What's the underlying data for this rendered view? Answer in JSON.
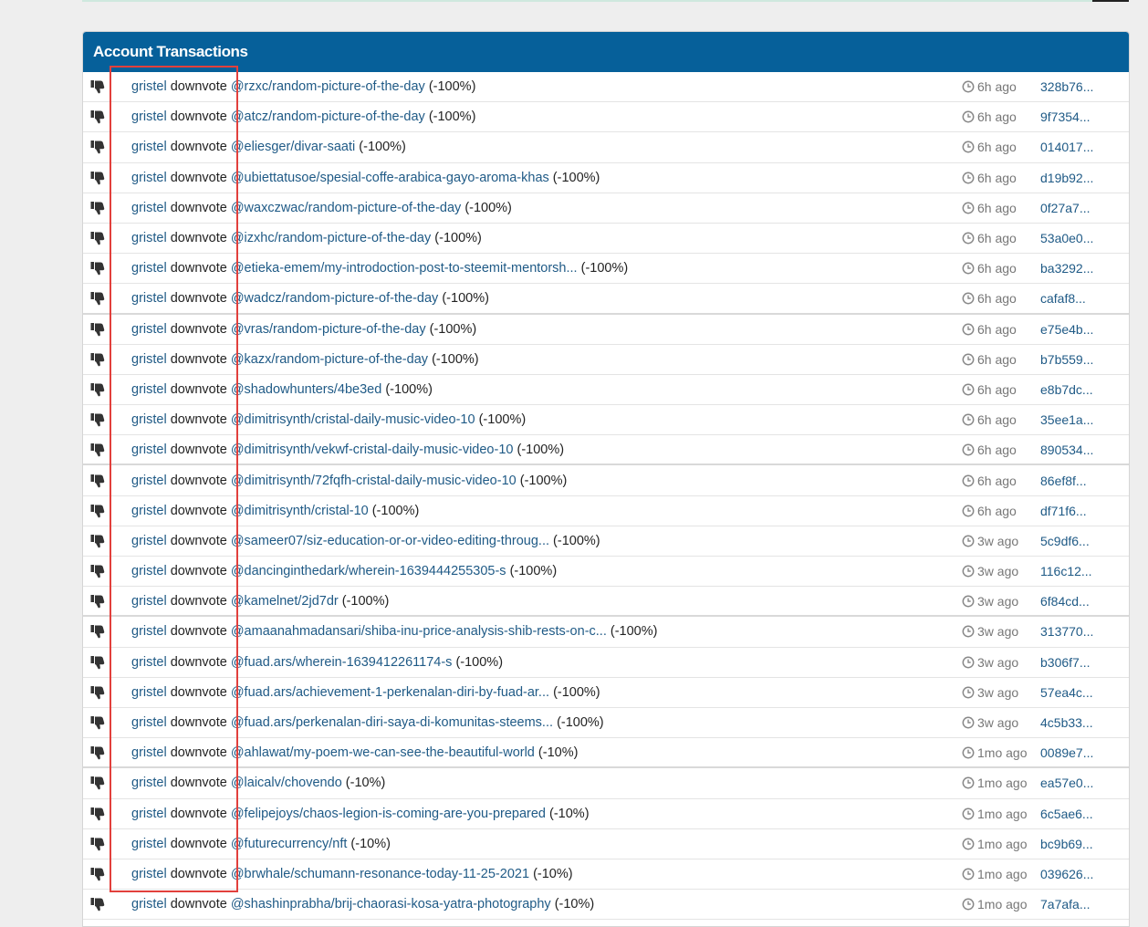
{
  "panel": {
    "title": "Account Transactions"
  },
  "colors": {
    "header": "#06609a",
    "link": "#1f5a86",
    "highlight": "#e2403c"
  },
  "icons": {
    "vote": "thumbs-down-icon",
    "time": "clock-icon"
  },
  "transactions": [
    {
      "voter": "gristel",
      "action": "downvote",
      "post": "@rzxc/random-picture-of-the-day",
      "weight": "(-100%)",
      "age": "6h ago",
      "tx": "328b76..."
    },
    {
      "voter": "gristel",
      "action": "downvote",
      "post": "@atcz/random-picture-of-the-day",
      "weight": "(-100%)",
      "age": "6h ago",
      "tx": "9f7354..."
    },
    {
      "voter": "gristel",
      "action": "downvote",
      "post": "@eliesger/divar-saati",
      "weight": "(-100%)",
      "age": "6h ago",
      "tx": "014017..."
    },
    {
      "voter": "gristel",
      "action": "downvote",
      "post": "@ubiettatusoe/spesial-coffe-arabica-gayo-aroma-khas",
      "weight": "(-100%)",
      "age": "6h ago",
      "tx": "d19b92..."
    },
    {
      "voter": "gristel",
      "action": "downvote",
      "post": "@waxczwac/random-picture-of-the-day",
      "weight": "(-100%)",
      "age": "6h ago",
      "tx": "0f27a7..."
    },
    {
      "voter": "gristel",
      "action": "downvote",
      "post": "@izxhc/random-picture-of-the-day",
      "weight": "(-100%)",
      "age": "6h ago",
      "tx": "53a0e0..."
    },
    {
      "voter": "gristel",
      "action": "downvote",
      "post": "@etieka-emem/my-introdoction-post-to-steemit-mentorsh...",
      "weight": "(-100%)",
      "age": "6h ago",
      "tx": "ba3292..."
    },
    {
      "voter": "gristel",
      "action": "downvote",
      "post": "@wadcz/random-picture-of-the-day",
      "weight": "(-100%)",
      "age": "6h ago",
      "tx": "cafaf8..."
    },
    {
      "voter": "gristel",
      "action": "downvote",
      "post": "@vras/random-picture-of-the-day",
      "weight": "(-100%)",
      "age": "6h ago",
      "tx": "e75e4b..."
    },
    {
      "voter": "gristel",
      "action": "downvote",
      "post": "@kazx/random-picture-of-the-day",
      "weight": "(-100%)",
      "age": "6h ago",
      "tx": "b7b559..."
    },
    {
      "voter": "gristel",
      "action": "downvote",
      "post": "@shadowhunters/4be3ed",
      "weight": "(-100%)",
      "age": "6h ago",
      "tx": "e8b7dc..."
    },
    {
      "voter": "gristel",
      "action": "downvote",
      "post": "@dimitrisynth/cristal-daily-music-video-10",
      "weight": "(-100%)",
      "age": "6h ago",
      "tx": "35ee1a..."
    },
    {
      "voter": "gristel",
      "action": "downvote",
      "post": "@dimitrisynth/vekwf-cristal-daily-music-video-10",
      "weight": "(-100%)",
      "age": "6h ago",
      "tx": "890534..."
    },
    {
      "voter": "gristel",
      "action": "downvote",
      "post": "@dimitrisynth/72fqfh-cristal-daily-music-video-10",
      "weight": "(-100%)",
      "age": "6h ago",
      "tx": "86ef8f..."
    },
    {
      "voter": "gristel",
      "action": "downvote",
      "post": "@dimitrisynth/cristal-10",
      "weight": "(-100%)",
      "age": "6h ago",
      "tx": "df71f6..."
    },
    {
      "voter": "gristel",
      "action": "downvote",
      "post": "@sameer07/siz-education-or-or-video-editing-throug...",
      "weight": "(-100%)",
      "age": "3w ago",
      "tx": "5c9df6..."
    },
    {
      "voter": "gristel",
      "action": "downvote",
      "post": "@dancinginthedark/wherein-1639444255305-s",
      "weight": "(-100%)",
      "age": "3w ago",
      "tx": "116c12..."
    },
    {
      "voter": "gristel",
      "action": "downvote",
      "post": "@kamelnet/2jd7dr",
      "weight": "(-100%)",
      "age": "3w ago",
      "tx": "6f84cd..."
    },
    {
      "voter": "gristel",
      "action": "downvote",
      "post": "@amaanahmadansari/shiba-inu-price-analysis-shib-rests-on-c...",
      "weight": "(-100%)",
      "age": "3w ago",
      "tx": "313770..."
    },
    {
      "voter": "gristel",
      "action": "downvote",
      "post": "@fuad.ars/wherein-1639412261174-s",
      "weight": "(-100%)",
      "age": "3w ago",
      "tx": "b306f7..."
    },
    {
      "voter": "gristel",
      "action": "downvote",
      "post": "@fuad.ars/achievement-1-perkenalan-diri-by-fuad-ar...",
      "weight": "(-100%)",
      "age": "3w ago",
      "tx": "57ea4c..."
    },
    {
      "voter": "gristel",
      "action": "downvote",
      "post": "@fuad.ars/perkenalan-diri-saya-di-komunitas-steems...",
      "weight": "(-100%)",
      "age": "3w ago",
      "tx": "4c5b33..."
    },
    {
      "voter": "gristel",
      "action": "downvote",
      "post": "@ahlawat/my-poem-we-can-see-the-beautiful-world",
      "weight": "(-10%)",
      "age": "1mo ago",
      "tx": "0089e7..."
    },
    {
      "voter": "gristel",
      "action": "downvote",
      "post": "@laicalv/chovendo",
      "weight": "(-10%)",
      "age": "1mo ago",
      "tx": "ea57e0..."
    },
    {
      "voter": "gristel",
      "action": "downvote",
      "post": "@felipejoys/chaos-legion-is-coming-are-you-prepared",
      "weight": "(-10%)",
      "age": "1mo ago",
      "tx": "6c5ae6..."
    },
    {
      "voter": "gristel",
      "action": "downvote",
      "post": "@futurecurrency/nft",
      "weight": "(-10%)",
      "age": "1mo ago",
      "tx": "bc9b69..."
    },
    {
      "voter": "gristel",
      "action": "downvote",
      "post": "@brwhale/schumann-resonance-today-11-25-2021",
      "weight": "(-10%)",
      "age": "1mo ago",
      "tx": "039626..."
    },
    {
      "voter": "gristel",
      "action": "downvote",
      "post": "@shashinprabha/brij-chaorasi-kosa-yatra-photography",
      "weight": "(-10%)",
      "age": "1mo ago",
      "tx": "7a7afa..."
    }
  ]
}
